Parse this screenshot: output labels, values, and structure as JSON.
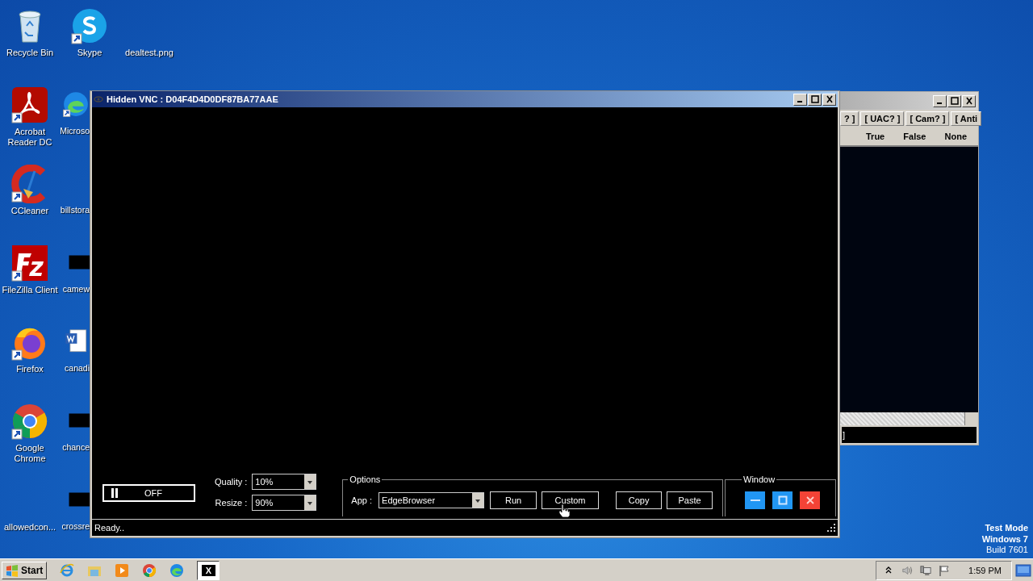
{
  "desktop": {
    "icon_columns": [
      [
        {
          "label": "Recycle Bin",
          "kind": "recycle-bin",
          "shortcut": false
        },
        {
          "label": "Acrobat Reader DC",
          "kind": "acrobat",
          "shortcut": true
        },
        {
          "label": "CCleaner",
          "kind": "ccleaner",
          "shortcut": true
        },
        {
          "label": "FileZilla Client",
          "kind": "filezilla",
          "shortcut": true
        },
        {
          "label": "Firefox",
          "kind": "firefox",
          "shortcut": true
        },
        {
          "label": "Google Chrome",
          "kind": "chrome",
          "shortcut": true
        },
        {
          "label": "allowedcon...",
          "kind": "blank"
        }
      ],
      [
        {
          "label": "Skype",
          "kind": "skype",
          "shortcut": true
        },
        {
          "label": "Microso",
          "kind": "edge",
          "shortcut": true
        },
        {
          "label": "billstora",
          "kind": "blank"
        },
        {
          "label": "camew",
          "kind": "black",
          "shortcut": false
        },
        {
          "label": "canadi",
          "kind": "word",
          "shortcut": false
        },
        {
          "label": "chance",
          "kind": "black",
          "shortcut": false
        },
        {
          "label": "crossre",
          "kind": "black",
          "shortcut": false
        }
      ],
      [
        {
          "label": "dealtest.png",
          "kind": "blank"
        }
      ]
    ]
  },
  "back_window": {
    "header_cells": [
      "? ]",
      "[ UAC? ]",
      "[ Cam? ]",
      "[ Anti"
    ],
    "row": [
      "True",
      "False",
      "None"
    ],
    "status": "]"
  },
  "main_window": {
    "title": "Hidden VNC : D04F4D4D0DF87BA77AAE",
    "toggle": {
      "label": "OFF",
      "on": false
    },
    "quality": {
      "label": "Quality :",
      "value": "10%"
    },
    "resize": {
      "label": "Resize :",
      "value": "90%"
    },
    "options": {
      "legend": "Options",
      "app_label": "App :",
      "app_value": "EdgeBrowser",
      "buttons": [
        "Run",
        "Custom",
        "Copy",
        "Paste"
      ]
    },
    "window_group": {
      "legend": "Window",
      "buttons": [
        {
          "kind": "minimize"
        },
        {
          "kind": "maximize"
        },
        {
          "kind": "close"
        }
      ]
    },
    "status": "Ready.."
  },
  "os_info": [
    "Test Mode",
    "Windows 7",
    "Build 7601"
  ],
  "taskbar": {
    "start": "Start",
    "quick_launch": [
      {
        "kind": "ie"
      },
      {
        "kind": "folder"
      },
      {
        "kind": "media"
      },
      {
        "kind": "chrome"
      },
      {
        "kind": "edge"
      }
    ],
    "tasks": [
      {
        "label": "X",
        "selected": true
      }
    ],
    "tray": [
      {
        "kind": "chevron"
      },
      {
        "kind": "volume"
      },
      {
        "kind": "network"
      },
      {
        "kind": "flag"
      }
    ],
    "clock": "1:59 PM"
  }
}
